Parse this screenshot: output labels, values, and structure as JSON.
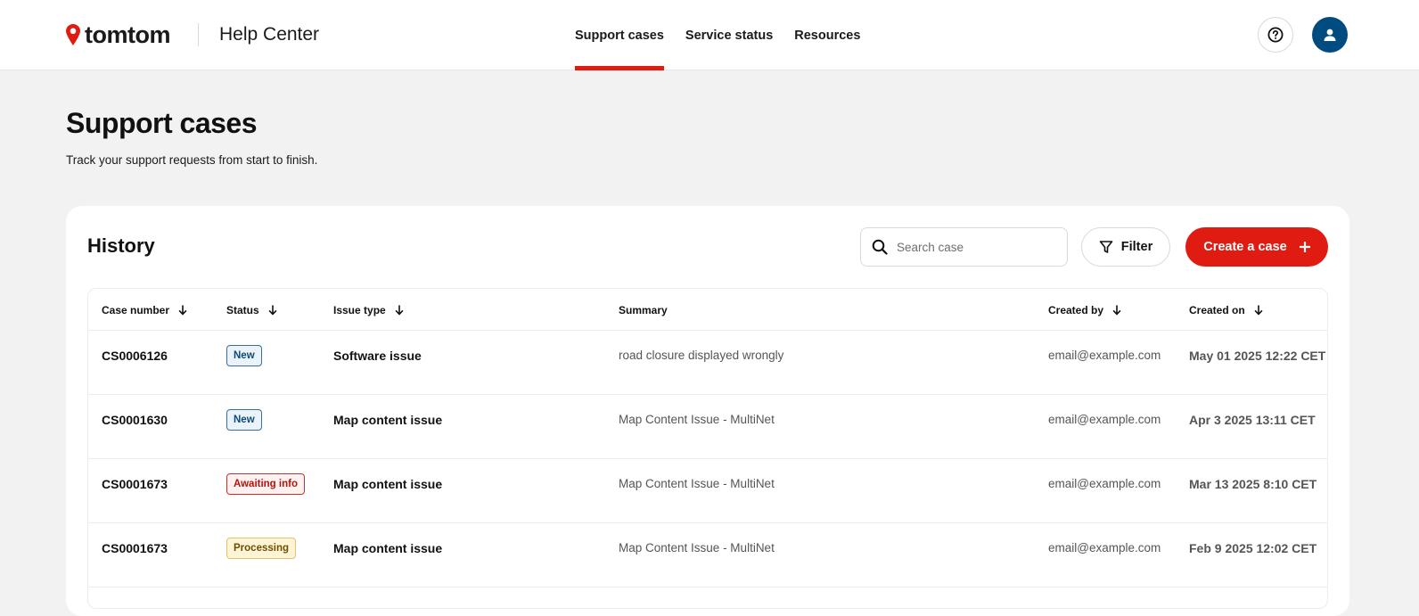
{
  "header": {
    "logo_text": "tomtom",
    "app_title": "Help Center",
    "nav": [
      {
        "label": "Support cases",
        "active": true
      },
      {
        "label": "Service status",
        "active": false
      },
      {
        "label": "Resources",
        "active": false
      }
    ],
    "help_icon": "question-circle-icon",
    "user_icon": "user-icon"
  },
  "page": {
    "title": "Support cases",
    "subtitle": "Track your support requests from start to finish."
  },
  "history": {
    "title": "History",
    "search_placeholder": "Search case",
    "filter_label": "Filter",
    "create_label": "Create a case",
    "columns": [
      "Case number",
      "Status",
      "Issue type",
      "Summary",
      "Created by",
      "Created on"
    ],
    "rows": [
      {
        "case": "CS0006126",
        "status": "New",
        "status_kind": "new",
        "type": "Software issue",
        "summary": "road closure displayed wrongly",
        "by": "email@example.com",
        "on": "May 01 2025 12:22 CET"
      },
      {
        "case": "CS0001630",
        "status": "New",
        "status_kind": "new",
        "type": "Map content issue",
        "summary": "Map Content Issue - MultiNet",
        "by": "email@example.com",
        "on": "Apr 3 2025 13:11 CET"
      },
      {
        "case": "CS0001673",
        "status": "Awaiting info",
        "status_kind": "await",
        "type": "Map content issue",
        "summary": "Map Content Issue - MultiNet",
        "by": "email@example.com",
        "on": "Mar 13 2025 8:10 CET"
      },
      {
        "case": "CS0001673",
        "status": "Processing",
        "status_kind": "proc",
        "type": "Map content issue",
        "summary": "Map Content Issue - MultiNet",
        "by": "email@example.com",
        "on": "Feb 9 2025 12:02 CET"
      }
    ]
  },
  "colors": {
    "brand_red": "#df1b12",
    "avatar_blue": "#004b7f"
  }
}
